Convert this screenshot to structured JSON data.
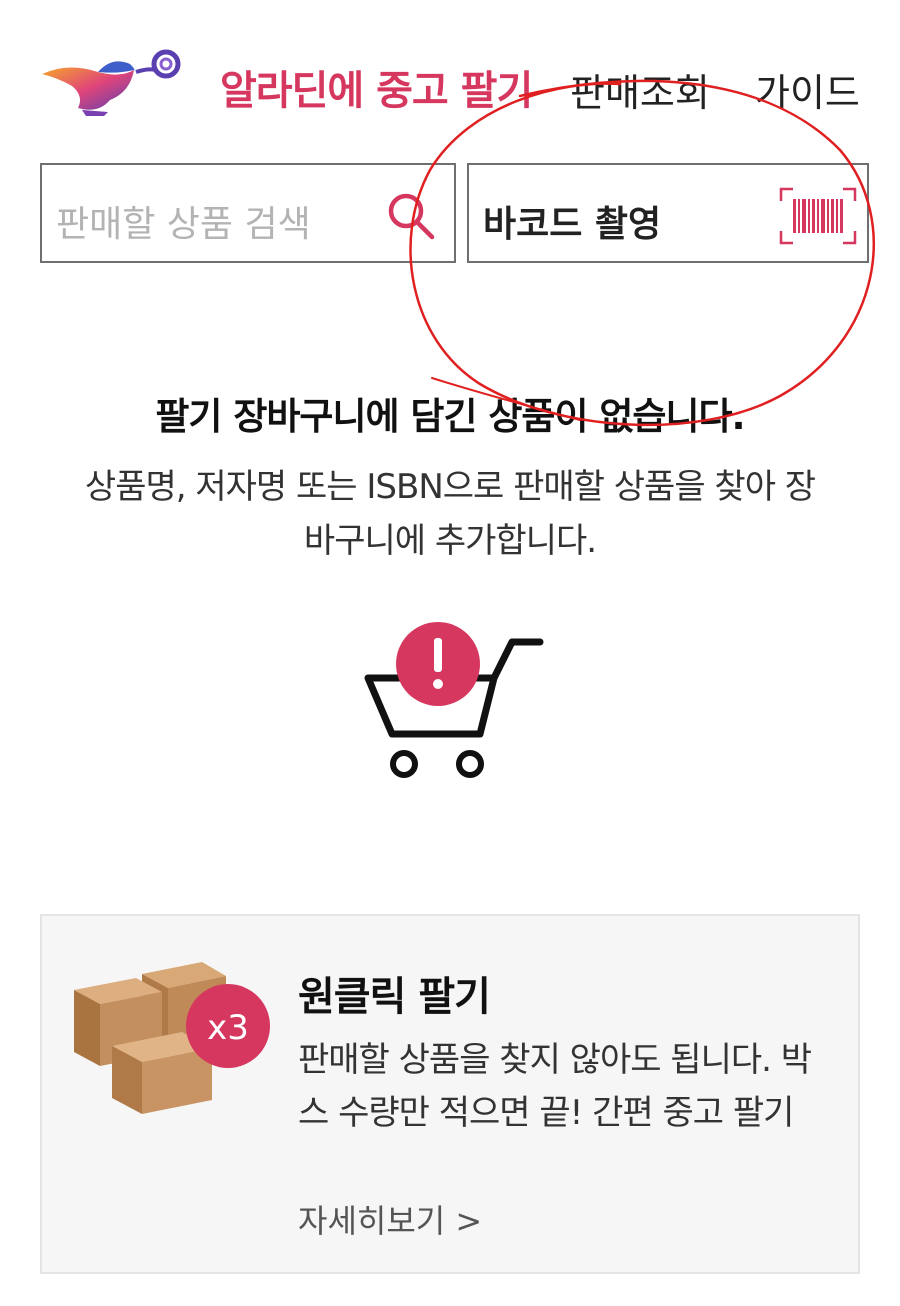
{
  "header": {
    "brand_title": "알라딘에 중고 팔기",
    "nav": {
      "sales_lookup": "판매조회",
      "guide": "가이드"
    }
  },
  "search": {
    "placeholder": "판매할 상품 검색"
  },
  "barcode": {
    "label": "바코드 촬영"
  },
  "empty_state": {
    "title": "팔기 장바구니에 담긴 상품이 없습니다.",
    "description": "상품명, 저자명 또는 ISBN으로 판매할 상품을 찾아 장바구니에 추가합니다."
  },
  "one_click": {
    "badge": "x3",
    "title": "원클릭 팔기",
    "description": "판매할 상품을 찾지 않아도 됩니다. 박스 수량만 적으면 끝! 간편 중고 팔기",
    "more_link": "자세히보기 >"
  },
  "colors": {
    "accent": "#d6375f",
    "annotation": "#e02020",
    "border": "#6f6f6f",
    "panel_bg": "#f6f6f6"
  },
  "icons": [
    "magic-lamp-logo",
    "search-icon",
    "barcode-icon",
    "cart-alert-icon",
    "boxes-icon"
  ]
}
